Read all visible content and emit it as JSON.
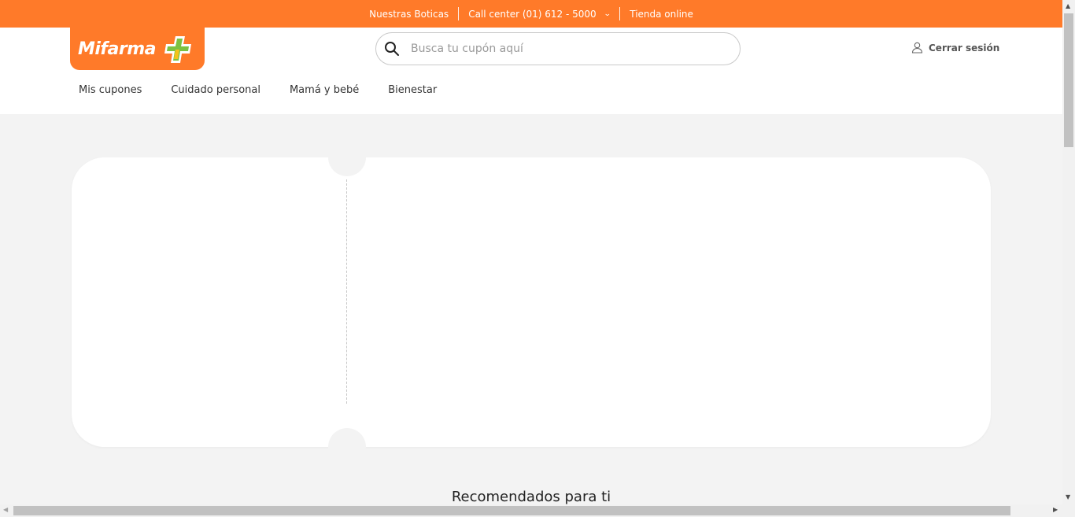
{
  "topbar": {
    "stores_label": "Nuestras Boticas",
    "call_center_label": "Call center (01) 612 - 5000",
    "online_store_label": "Tienda online"
  },
  "logo": {
    "text": "Mifarma"
  },
  "search": {
    "placeholder": "Busca tu cupón aquí",
    "value": ""
  },
  "account": {
    "logout_label": "Cerrar sesión"
  },
  "nav": {
    "items": [
      {
        "label": "Mis cupones"
      },
      {
        "label": "Cuidado personal"
      },
      {
        "label": "Mamá y bebé"
      },
      {
        "label": "Bienestar"
      }
    ]
  },
  "recommended": {
    "title": "Recomendados para ti"
  },
  "colors": {
    "brand_orange": "#ff7a29",
    "cross_green": "#7cc242",
    "cross_yellow": "#f4c21a",
    "background": "#f3f3f3"
  },
  "icons": [
    "chevron-down-icon",
    "mifarma-cross-icon",
    "search-icon",
    "user-icon"
  ]
}
